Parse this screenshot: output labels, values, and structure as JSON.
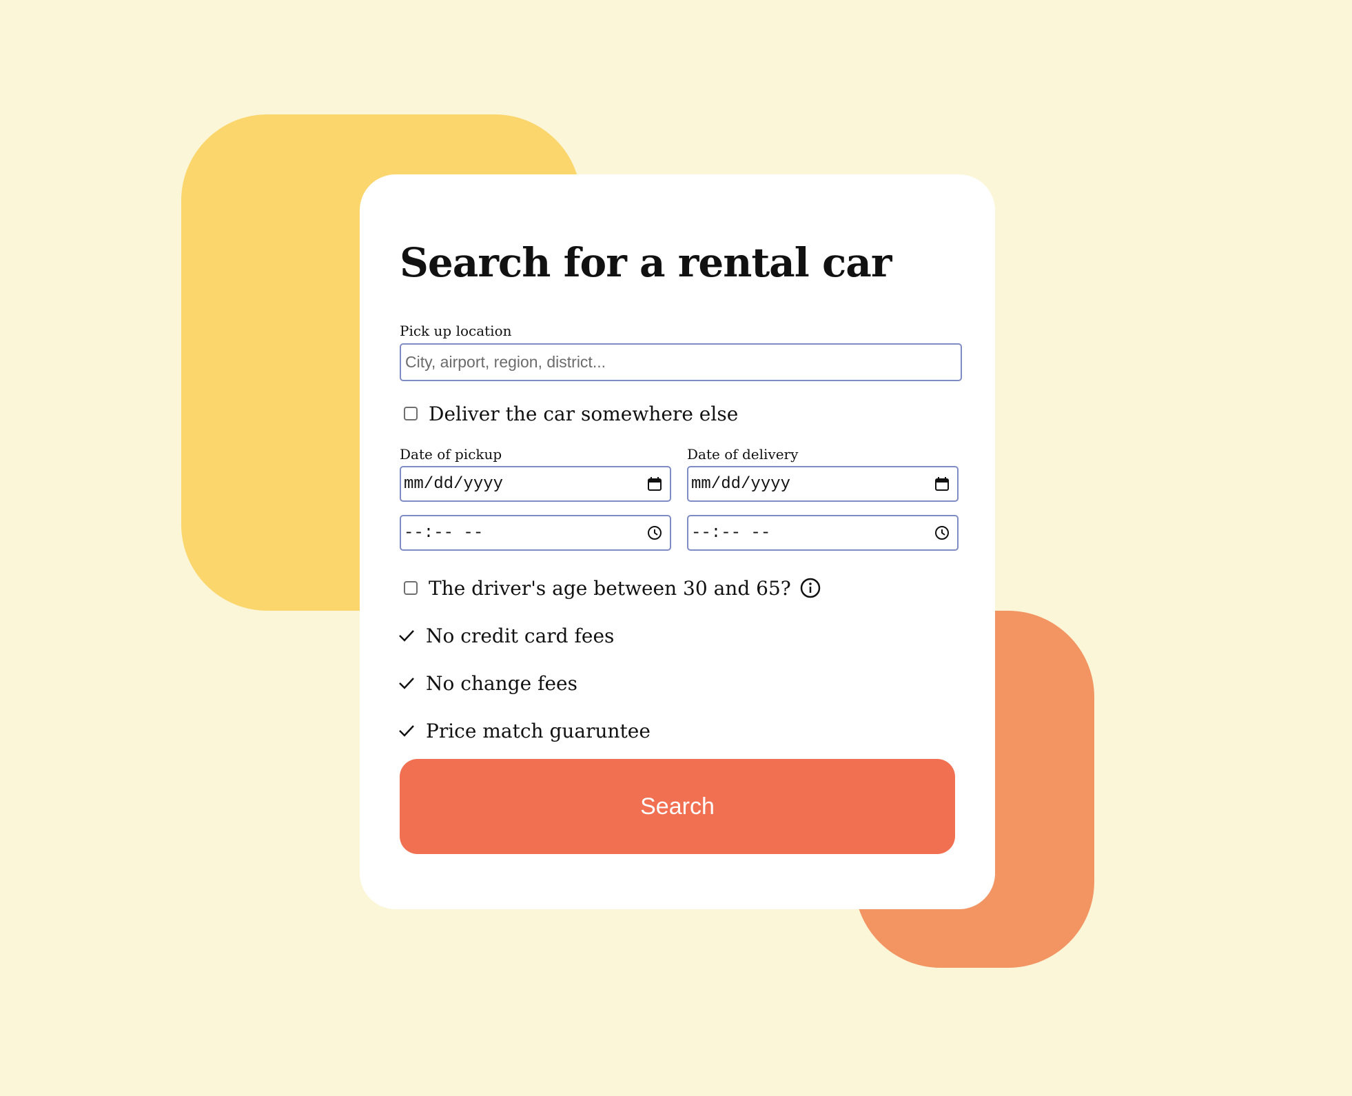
{
  "form": {
    "title": "Search for a rental car",
    "pickup_location": {
      "label": "Pick up location",
      "placeholder": "City, airport, region, district...",
      "value": ""
    },
    "deliver_elsewhere": {
      "label": "Deliver the car somewhere else",
      "checked": false
    },
    "date_of_pickup": {
      "label": "Date of pickup",
      "date_placeholder": "mm/dd/yyyy",
      "time_placeholder": "--:-- --"
    },
    "date_of_delivery": {
      "label": "Date of delivery",
      "date_placeholder": "mm/dd/yyyy",
      "time_placeholder": "--:-- --"
    },
    "driver_age": {
      "label": "The driver's age between 30 and 65?",
      "checked": false,
      "info_icon": "info-icon"
    },
    "perks": [
      "No credit card fees",
      "No change fees",
      "Price match guaruntee"
    ],
    "search_button": "Search"
  },
  "icons": {
    "date": "calendar-icon",
    "time": "clock-icon",
    "perk": "checkmark-icon"
  },
  "colors": {
    "background": "#FCF6D8",
    "blob_yellow": "#FAD66D",
    "blob_orange": "#F29563",
    "card": "#FFFFFF",
    "input_border": "#7F8BC4",
    "button": "#F27052",
    "button_text": "#FFFFFF"
  }
}
